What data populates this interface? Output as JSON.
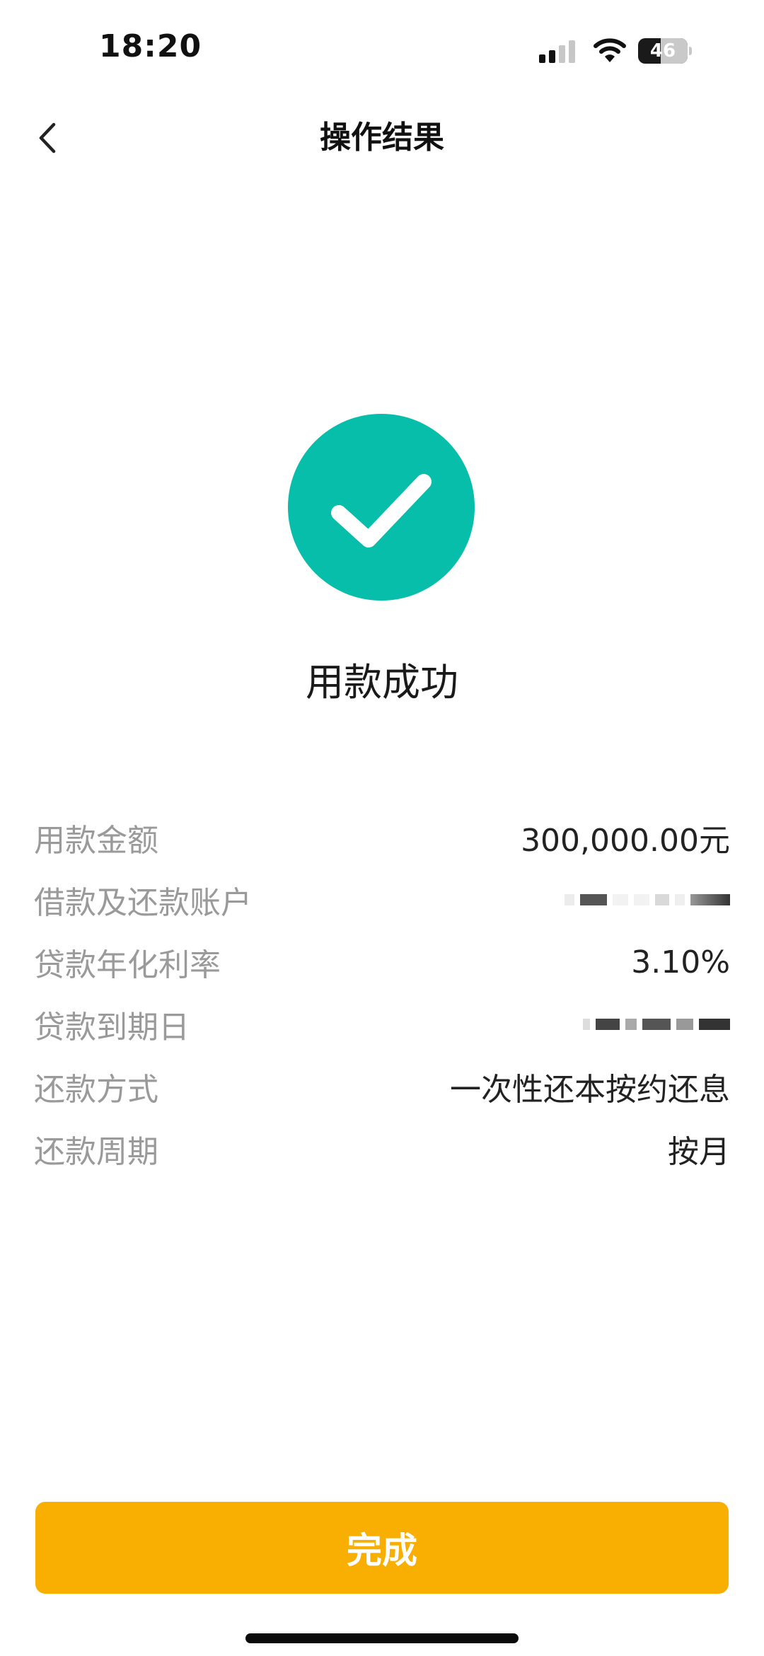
{
  "status_bar": {
    "time": "18:20",
    "battery_level": "46",
    "battery_fraction": 0.46,
    "signal_icon": "cellular-signal-icon",
    "wifi_icon": "wifi-icon"
  },
  "nav": {
    "back_icon": "chevron-left-icon",
    "title": "操作结果"
  },
  "result": {
    "icon": "check-circle-icon",
    "icon_color": "#06bea9",
    "message": "用款成功"
  },
  "details": [
    {
      "label": "用款金额",
      "value": "300,000.00元",
      "masked": false
    },
    {
      "label": "借款及还款账户",
      "value": "",
      "masked": true
    },
    {
      "label": "贷款年化利率",
      "value": "3.10%",
      "masked": false
    },
    {
      "label": "贷款到期日",
      "value": "",
      "masked": true
    },
    {
      "label": "还款方式",
      "value": "一次性还本按约还息",
      "masked": false
    },
    {
      "label": "还款周期",
      "value": "按月",
      "masked": false
    }
  ],
  "footer": {
    "done_label": "完成",
    "button_color": "#f9af02"
  }
}
